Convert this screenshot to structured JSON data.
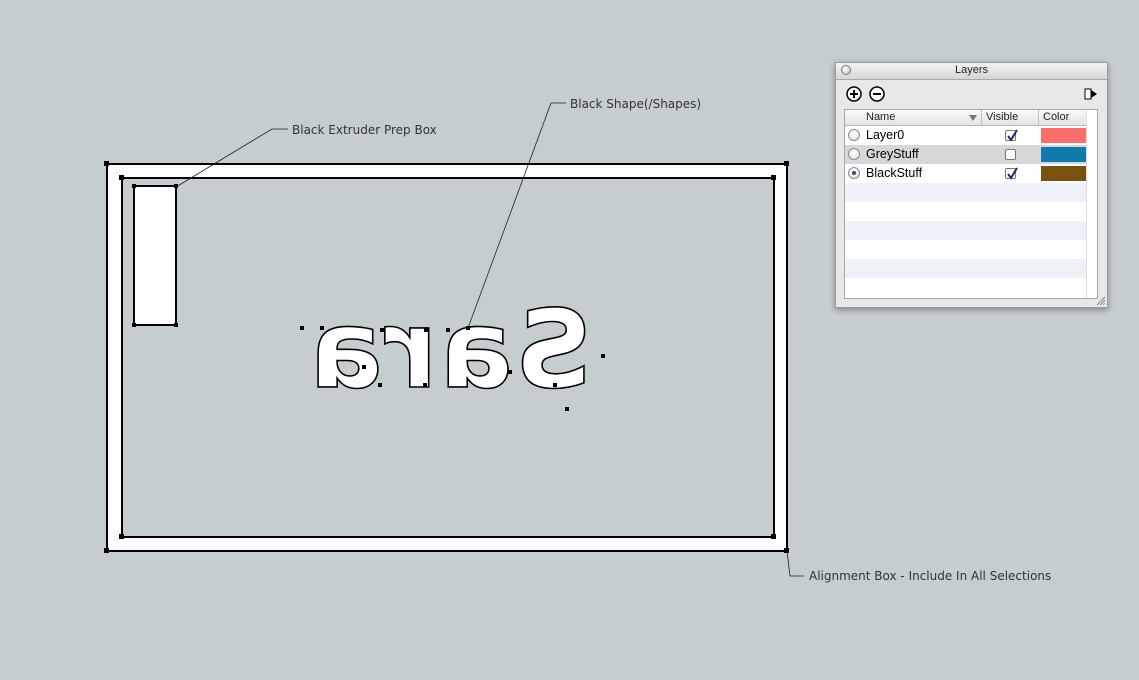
{
  "annotations": {
    "prep_box": "Black Extruder Prep Box",
    "shape": "Black Shape(/Shapes)",
    "alignment": "Alignment Box - Include  In All Selections"
  },
  "model_text": "Sara",
  "layers_panel": {
    "title": "Layers",
    "add_icon": "plus-circle-icon",
    "remove_icon": "minus-circle-icon",
    "details_icon": "details-arrow-icon",
    "columns": {
      "name": "Name",
      "visible": "Visible",
      "color": "Color"
    },
    "rows": [
      {
        "name": "Layer0",
        "active": false,
        "visible": true,
        "color": "#ff6f6a"
      },
      {
        "name": "GreyStuff",
        "active": false,
        "visible": false,
        "color": "#0f7aad"
      },
      {
        "name": "BlackStuff",
        "active": true,
        "visible": true,
        "color": "#7a5310"
      }
    ]
  },
  "colors": {
    "background": "#c5cdd0",
    "panel": "#e8e8e8"
  }
}
